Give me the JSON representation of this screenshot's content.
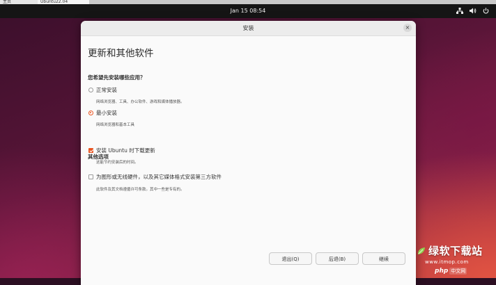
{
  "host": {
    "tabs": [
      "主页",
      "Ubuntu22.04"
    ]
  },
  "topbar": {
    "clock": "Jan 15  08:54",
    "tray_icons": [
      "network-icon",
      "volume-icon",
      "power-icon"
    ]
  },
  "window": {
    "title": "安装",
    "close_label": "×",
    "page_title": "更新和其他软件",
    "question": "您希望先安装哪些应用？",
    "options": [
      {
        "label": "正常安装",
        "desc": "网络浏览器、工具、办公软件、游戏和媒体播放器。",
        "selected": false
      },
      {
        "label": "最小安装",
        "desc": "网络浏览器和基本工具",
        "selected": true
      }
    ],
    "other_heading": "其他选项",
    "checks": [
      {
        "label": "安装 Ubuntu 时下载更新",
        "desc": "这能节约安装后的时间。",
        "checked": true
      },
      {
        "label": "为图形或无线硬件，以及其它媒体格式安装第三方软件",
        "desc": "此软件及其文档遵循许可条款。其中一些是专有的。",
        "checked": false
      }
    ],
    "buttons": {
      "quit": "退出(Q)",
      "back": "后退(B)",
      "next": "继续"
    }
  },
  "watermark": {
    "brand": "绿软下载站",
    "url": "www.itmop.com",
    "php": "php",
    "php_cn": "中文网"
  },
  "colors": {
    "accent": "#e95420",
    "topbar": "#151515"
  }
}
